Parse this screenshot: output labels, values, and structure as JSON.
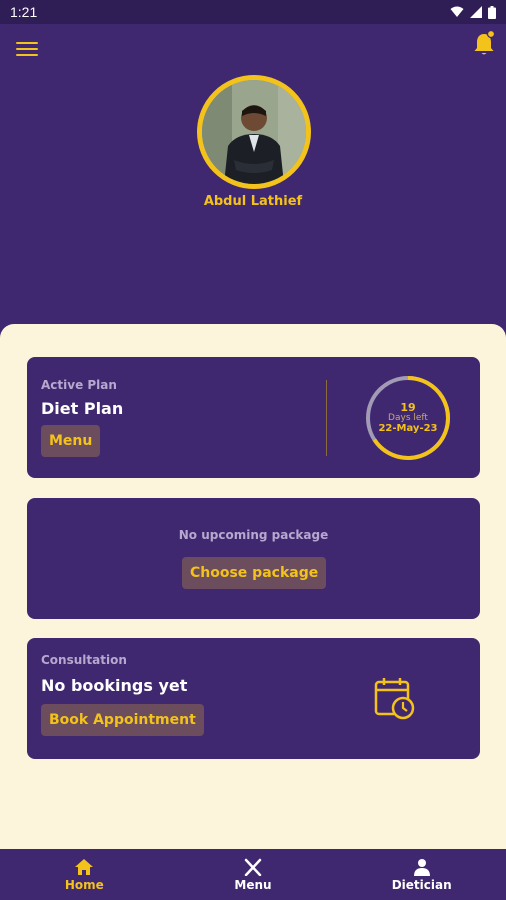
{
  "status_bar": {
    "time": "1:21"
  },
  "header": {
    "menu_icon": "hamburger-icon",
    "notification_icon": "bell-icon",
    "user_name": "Abdul Lathief"
  },
  "active_plan": {
    "label": "Active Plan",
    "title": "Diet Plan",
    "menu_button": "Menu",
    "days_count": "19",
    "days_caption": "Days left",
    "end_date": "22-May-23"
  },
  "upcoming_package": {
    "empty_text": "No upcoming package",
    "choose_button": "Choose package"
  },
  "consultation": {
    "label": "Consultation",
    "title": "No bookings yet",
    "book_button": "Book Appointment",
    "icon": "calendar-clock-icon"
  },
  "bottom_nav": {
    "items": [
      {
        "label": "Home",
        "icon": "home-icon",
        "active": true
      },
      {
        "label": "Menu",
        "icon": "fork-knife-icon",
        "active": false
      },
      {
        "label": "Dietician",
        "icon": "doctor-icon",
        "active": false
      }
    ]
  },
  "colors": {
    "primary": "#402870",
    "accent": "#f3c21b",
    "background": "#fdf4dc",
    "button_bg": "#6b4d5e"
  }
}
